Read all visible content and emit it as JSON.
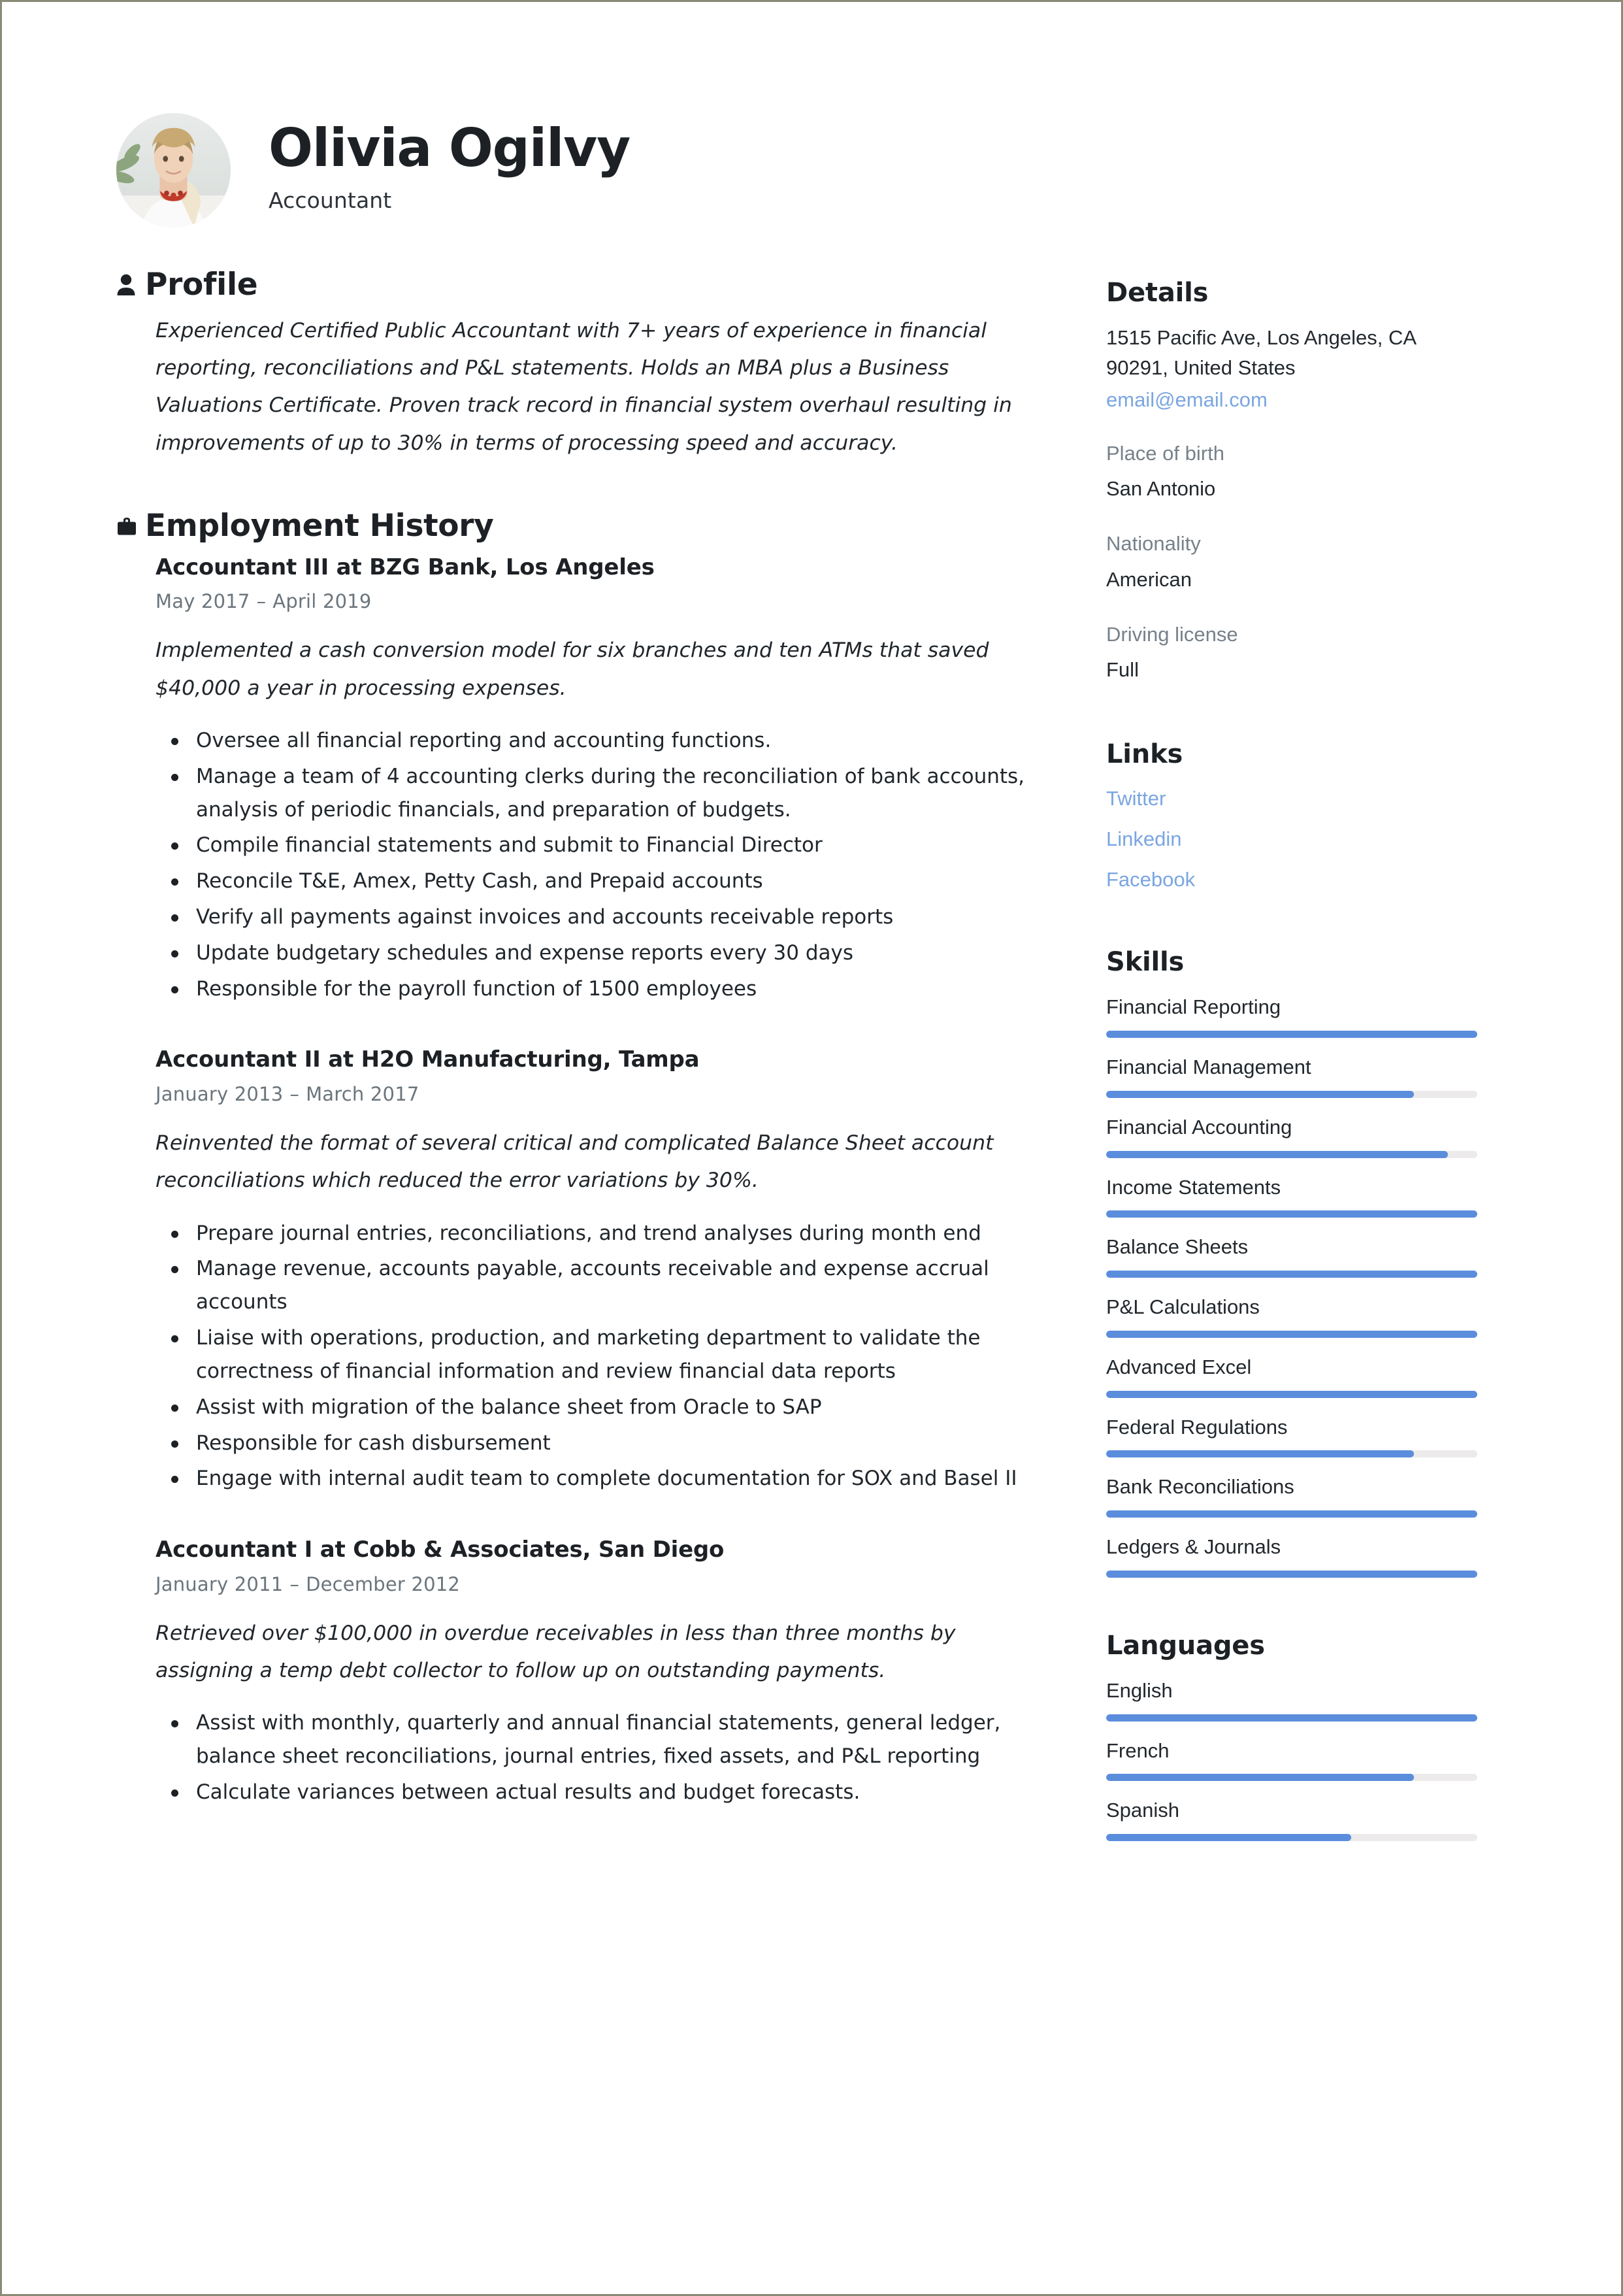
{
  "header": {
    "name": "Olivia Ogilvy",
    "job_title": "Accountant",
    "avatar_alt": "profile-photo"
  },
  "profile": {
    "heading": "Profile",
    "icon": "person-icon",
    "text": "Experienced Certified Public Accountant with 7+ years of experience in financial reporting, reconciliations and P&L statements. Holds an MBA plus a Business Valuations Certificate. Proven track record in financial system overhaul resulting in improvements of up to 30% in terms of processing speed and accuracy."
  },
  "employment": {
    "heading": "Employment History",
    "icon": "briefcase-icon",
    "jobs": [
      {
        "title": "Accountant III at BZG Bank, Los Angeles",
        "start": "May 2017",
        "end": "April 2019",
        "dash": "–",
        "summary": "Implemented a cash conversion model for six branches and ten ATMs that saved $40,000 a year in processing expenses.",
        "bullets": [
          "Oversee all financial reporting and accounting functions.",
          "Manage a team of 4 accounting clerks during the reconciliation of bank accounts, analysis of periodic financials, and preparation of budgets.",
          "Compile financial statements and submit to Financial Director",
          "Reconcile T&E, Amex, Petty Cash, and Prepaid accounts",
          "Verify all payments against invoices and accounts receivable reports",
          "Update budgetary schedules and expense reports every 30 days",
          "Responsible for the payroll function of 1500 employees"
        ]
      },
      {
        "title": "Accountant II at H2O Manufacturing, Tampa",
        "start": "January 2013",
        "end": "March 2017",
        "dash": "–",
        "summary": "Reinvented the format of several critical and complicated Balance Sheet account reconciliations which reduced the error variations by 30%.",
        "bullets": [
          "Prepare journal entries, reconciliations, and trend analyses during month end",
          "Manage revenue, accounts payable, accounts receivable and expense accrual accounts",
          "Liaise with operations, production, and marketing department to validate the correctness of financial information and review financial data reports",
          "Assist with migration of the balance sheet from Oracle to SAP",
          "Responsible for cash disbursement",
          "Engage with internal audit team to complete documentation for SOX and Basel II"
        ]
      },
      {
        "title": "Accountant I at Cobb & Associates, San Diego",
        "start": "January 2011",
        "end": "December 2012",
        "dash": "–",
        "summary": "Retrieved over $100,000 in overdue receivables in less than three months by assigning a temp debt collector to follow up on outstanding payments.",
        "bullets": [
          "Assist with monthly, quarterly and annual financial statements, general ledger, balance sheet reconciliations, journal entries, fixed assets, and P&L reporting",
          "Calculate variances between actual results and budget forecasts."
        ]
      }
    ]
  },
  "details": {
    "heading": "Details",
    "address_line1": "1515 Pacific Ave, Los Angeles, CA",
    "address_line2": "90291, United States",
    "email": "email@email.com",
    "fields": [
      {
        "label": "Place of birth",
        "value": "San Antonio"
      },
      {
        "label": "Nationality",
        "value": "American"
      },
      {
        "label": "Driving license",
        "value": "Full"
      }
    ]
  },
  "links": {
    "heading": "Links",
    "items": [
      "Twitter",
      "Linkedin",
      "Facebook"
    ]
  },
  "skills": {
    "heading": "Skills",
    "items": [
      {
        "label": "Financial Reporting",
        "level": 100
      },
      {
        "label": "Financial Management",
        "level": 83
      },
      {
        "label": "Financial Accounting",
        "level": 92
      },
      {
        "label": "Income Statements",
        "level": 100
      },
      {
        "label": "Balance Sheets",
        "level": 100
      },
      {
        "label": "P&L Calculations",
        "level": 100
      },
      {
        "label": "Advanced Excel",
        "level": 100
      },
      {
        "label": "Federal Regulations",
        "level": 83
      },
      {
        "label": "Bank Reconciliations",
        "level": 100
      },
      {
        "label": "Ledgers & Journals",
        "level": 100
      }
    ]
  },
  "languages": {
    "heading": "Languages",
    "items": [
      {
        "label": "English",
        "level": 100
      },
      {
        "label": "French",
        "level": 83
      },
      {
        "label": "Spanish",
        "level": 66
      }
    ]
  },
  "colors": {
    "accent": "#5b8ddd",
    "link": "#7aa6e0",
    "track": "#eceaea",
    "text": "#20262b",
    "muted": "#6b757c",
    "border": "#8a8a78"
  }
}
